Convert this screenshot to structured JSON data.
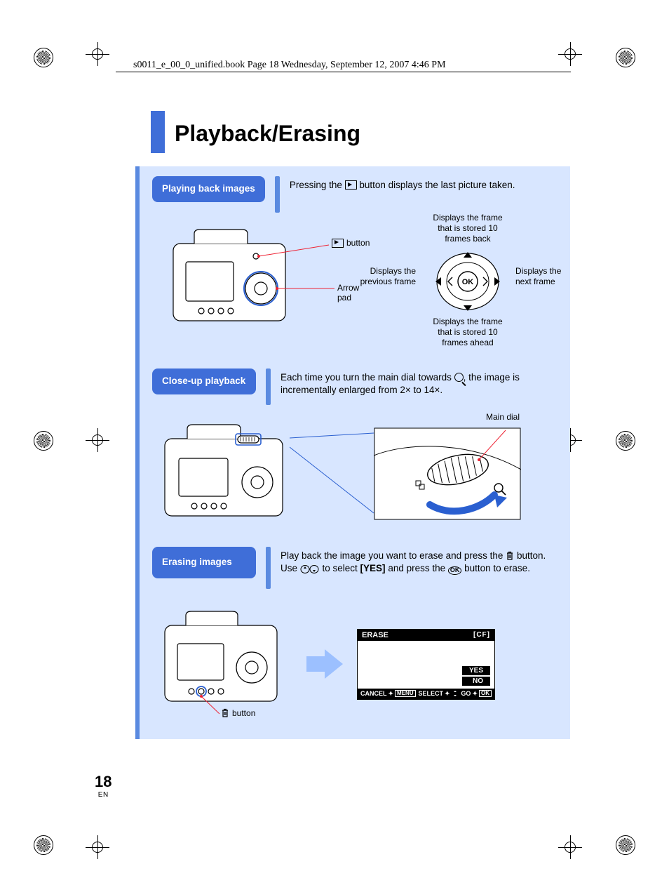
{
  "header_line": "s0011_e_00_0_unified.book  Page 18  Wednesday, September 12, 2007  4:46 PM",
  "title": "Playback/Erasing",
  "page_number": "18",
  "page_lang": "EN",
  "sec1": {
    "label": "Playing back images",
    "body_a": "Pressing the ",
    "body_b": " button displays the last picture taken.",
    "callout_play": " button",
    "callout_arrowpad": "Arrow pad",
    "dial_up": "Displays the frame that is stored 10 frames back",
    "dial_left": "Displays the previous frame",
    "dial_right": "Displays the next frame",
    "dial_down": "Displays the frame that is stored 10 frames ahead",
    "dial_ok": "OK"
  },
  "sec2": {
    "label": "Close-up playback",
    "body_a": "Each time you turn the main dial towards ",
    "body_b": ", the image is incrementally enlarged from 2× to 14×.",
    "callout_maindial": "Main dial"
  },
  "sec3": {
    "label": "Erasing images",
    "body_a": "Play back the image you want to erase and press the ",
    "body_b": " button.",
    "body_c": "Use ",
    "body_d": " to select ",
    "body_yes": "[YES]",
    "body_e": " and press the ",
    "body_f": " button to erase.",
    "callout_trash": " button",
    "screen": {
      "title": "ERASE",
      "cf": "[CF]",
      "yes": "YES",
      "no": "NO",
      "cancel": "CANCEL",
      "menu": "MENU",
      "select": "SELECT",
      "go": "GO",
      "ok": "OK"
    }
  }
}
